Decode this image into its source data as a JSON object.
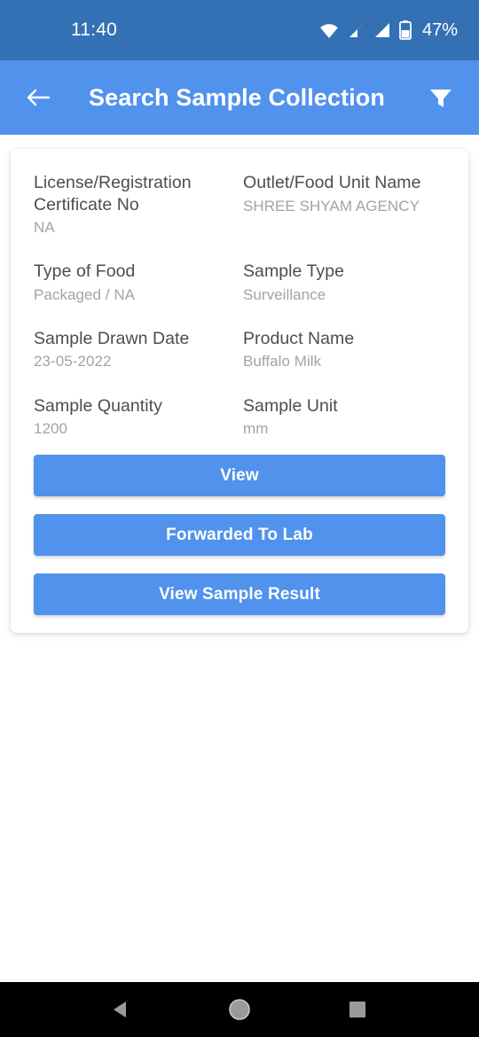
{
  "status_bar": {
    "time": "11:40",
    "battery_percent": "47%",
    "icons": [
      "wifi-icon",
      "signal-icon",
      "signal-icon",
      "battery-icon"
    ],
    "background_color": "#3470b4"
  },
  "app_bar": {
    "back_label": "back-arrow-icon",
    "title": "Search Sample Collection",
    "filter_label": "filter-icon",
    "background_color": "#5192ec"
  },
  "card": {
    "fields": [
      {
        "label": "License/Registration Certificate No",
        "value": "NA"
      },
      {
        "label": "Outlet/Food Unit Name",
        "value": "SHREE SHYAM AGENCY"
      },
      {
        "label": "Type of Food",
        "value": "Packaged / NA"
      },
      {
        "label": "Sample Type",
        "value": "Surveillance"
      },
      {
        "label": "Sample Drawn Date",
        "value": "23-05-2022"
      },
      {
        "label": "Product Name",
        "value": "Buffalo Milk"
      },
      {
        "label": "Sample Quantity",
        "value": "1200"
      },
      {
        "label": "Sample Unit",
        "value": "mm"
      }
    ],
    "buttons": [
      {
        "label": "View"
      },
      {
        "label": "Forwarded To Lab"
      },
      {
        "label": "View Sample Result"
      }
    ],
    "label_color": "#4d4d4d",
    "value_color": "#a3a3a3",
    "button_color": "#5192ec"
  },
  "nav_bar": {
    "items": [
      "back-triangle-icon",
      "home-circle-icon",
      "recents-square-icon"
    ],
    "background_color": "#000000"
  }
}
